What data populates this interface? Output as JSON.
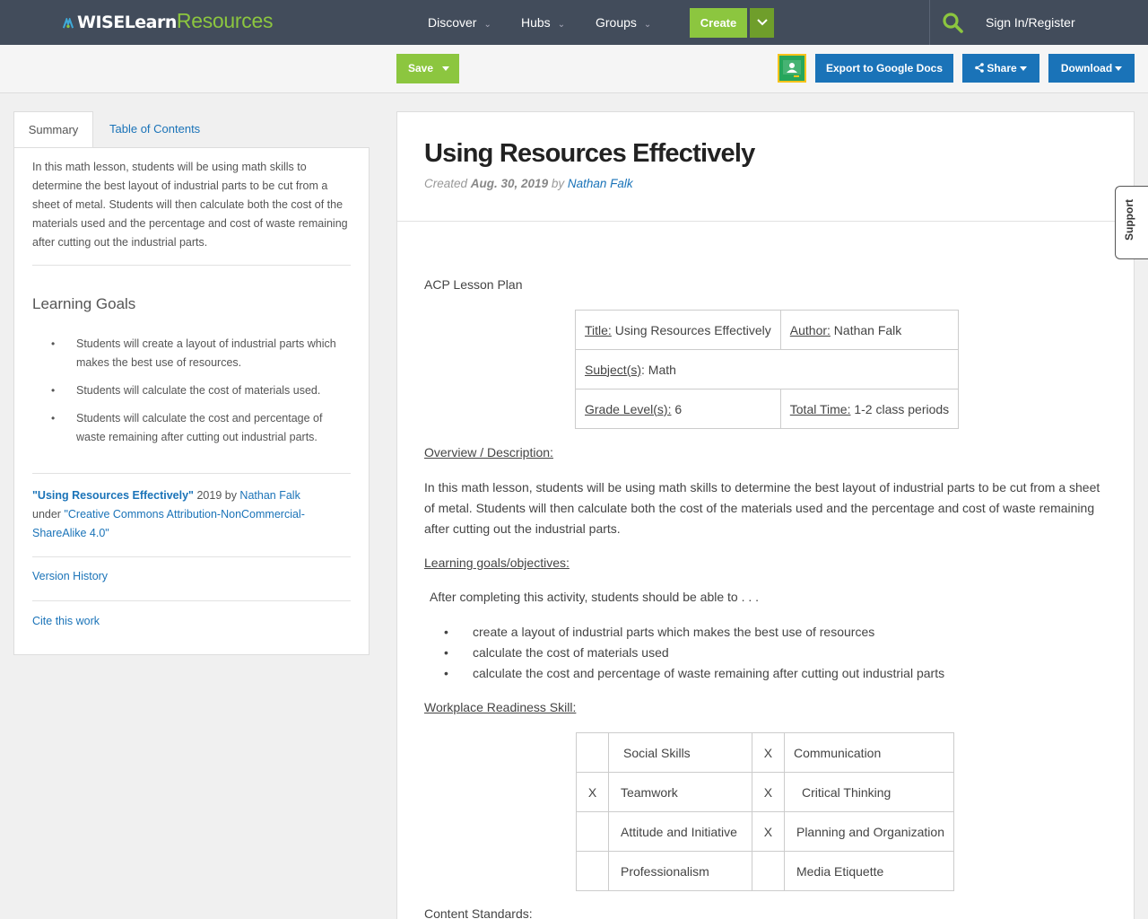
{
  "logo": {
    "part1": "WISELearn",
    "part2": "Resources"
  },
  "nav": {
    "discover": "Discover",
    "hubs": "Hubs",
    "groups": "Groups",
    "create": "Create",
    "signin": "Sign In/Register"
  },
  "toolbar": {
    "save": "Save",
    "export": "Export to Google Docs",
    "share": "Share",
    "download": "Download"
  },
  "sidebar": {
    "tabs": [
      "Summary",
      "Table of Contents"
    ],
    "summary": "In this math lesson, students will be using math skills to determine the best layout of industrial parts to be cut from a sheet of metal. Students will then calculate both the cost of the materials used and the percentage and cost of waste remaining after cutting out the industrial parts.",
    "goals_title": "Learning Goals",
    "goals": [
      "Students will create a layout of industrial parts which makes the best use of resources.",
      "Students will calculate the cost of materials used.",
      "Students will calculate the cost and percentage of waste remaining after cutting out industrial parts."
    ],
    "license_title": "\"Using Resources Effectively\"",
    "license_year_by": " 2019 by ",
    "license_author": "Nathan Falk",
    "license_under": "under ",
    "license_name": "\"Creative Commons Attribution-NonCommercial-ShareAlike 4.0\"",
    "version_history": "Version History",
    "cite": "Cite this work"
  },
  "main": {
    "title": "Using Resources Effectively",
    "meta_created": "Created ",
    "meta_date": "Aug. 30, 2019",
    "meta_by": " by ",
    "meta_author": "Nathan Falk",
    "acp": "ACP Lesson Plan",
    "plan": {
      "title_label": "Title:",
      "title_value": " Using Resources Effectively",
      "author_label": "Author:",
      "author_value": " Nathan Falk",
      "subject_label": "Subject(s)",
      "subject_value": ":  Math",
      "grade_label": "Grade Level(s):",
      "grade_value": " 6",
      "time_label": "Total Time:",
      "time_value": " 1-2 class periods"
    },
    "overview_label": "Overview / Description:",
    "overview_text": "In this math lesson, students will be using math skills to determine the best layout of industrial parts to be cut from a sheet of metal. Students will then calculate both the cost of the materials used and the percentage and cost of waste remaining after cutting out the industrial parts.",
    "goals_label": "Learning goals/objectives:",
    "goals_intro": "After completing this activity, students should be able to . . .",
    "objectives": [
      "create a layout of industrial parts which makes the best use of resources",
      "calculate the cost of materials used",
      "calculate the cost and percentage of waste remaining after cutting out industrial parts"
    ],
    "skill_label": "Workplace Readiness Skill:",
    "skills": [
      {
        "mark1": "",
        "skill1": "Social Skills",
        "mark2": "X",
        "skill2": "Communication"
      },
      {
        "mark1": "X",
        "skill1": "Teamwork",
        "mark2": "X",
        "skill2": "Critical Thinking"
      },
      {
        "mark1": "",
        "skill1": "Attitude and Initiative",
        "mark2": "X",
        "skill2": "Planning and Organization"
      },
      {
        "mark1": "",
        "skill1": "Professionalism",
        "mark2": "",
        "skill2": "Media Etiquette"
      }
    ],
    "standards_label": "Content Standards:"
  },
  "support": "Support"
}
